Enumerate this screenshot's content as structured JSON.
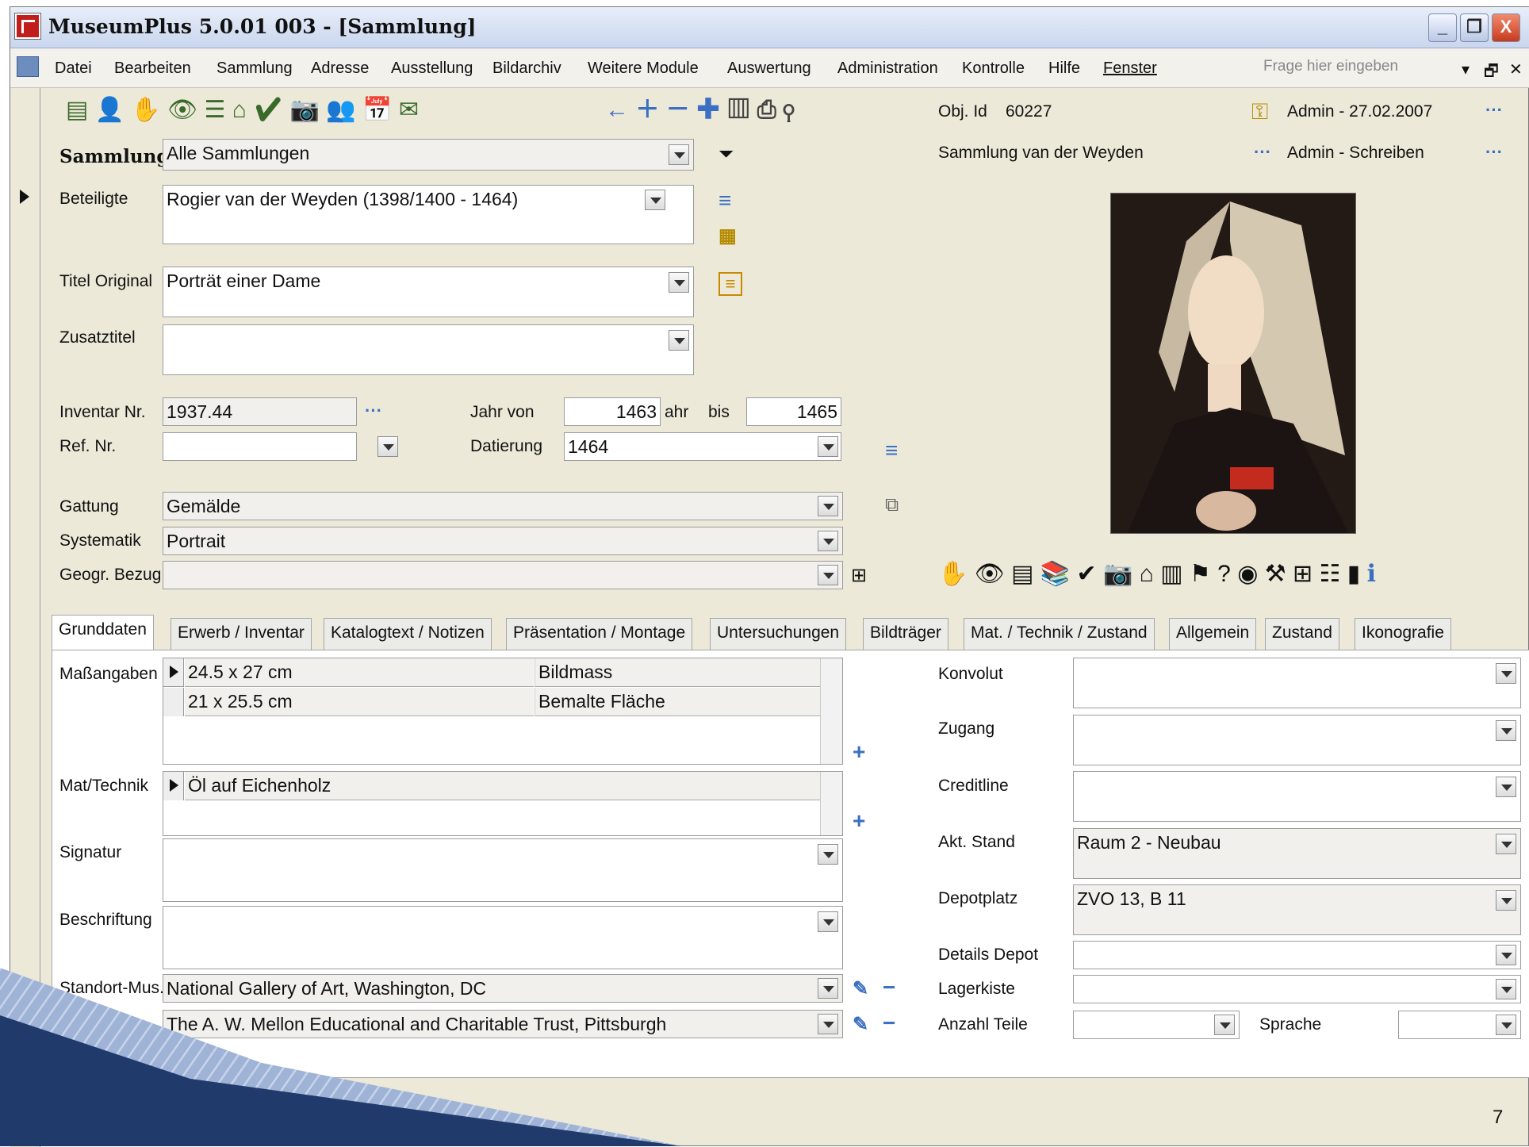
{
  "window": {
    "title": "MuseumPlus 5.0.01 003 - [Sammlung]",
    "controls": [
      "_",
      "❐",
      "X"
    ]
  },
  "menu": {
    "items": [
      "Datei",
      "Bearbeiten",
      "Sammlung",
      "Adresse",
      "Ausstellung",
      "Bildarchiv",
      "Weitere Module",
      "Auswertung",
      "Administration",
      "Kontrolle",
      "Hilfe",
      "Fenster"
    ],
    "help_placeholder": "Frage hier eingeben",
    "right_controls": [
      "▾",
      "🗗",
      "✕"
    ]
  },
  "toolbar": {
    "obj_label": "Obj. Id",
    "obj_id": "60227",
    "admin_created": "Admin - 27.02.2007",
    "admin_write": "Admin - Schreiben",
    "sammlung_selected": "Sammlung van der Weyden",
    "more": "···"
  },
  "form": {
    "sammlung_label": "Sammlung",
    "sammlung_value": "Alle Sammlungen",
    "beteiligte_label": "Beteiligte",
    "beteiligte_value": "Rogier van der Weyden (1398/1400 - 1464)",
    "titel_label": "Titel Original",
    "titel_value": "Porträt einer Dame",
    "zusatz_label": "Zusatztitel",
    "zusatz_value": "",
    "inventar_label": "Inventar Nr.",
    "inventar_value": "1937.44",
    "jahr_von_label": "Jahr von",
    "jahr_von_value": "1463",
    "jahr_suffix": "ahr",
    "bis_label": "bis",
    "bis_value": "1465",
    "ref_label": "Ref. Nr.",
    "ref_value": "",
    "datierung_label": "Datierung",
    "datierung_value": "1464",
    "gattung_label": "Gattung",
    "gattung_value": "Gemälde",
    "systematik_label": "Systematik",
    "systematik_value": "Portrait",
    "geogr_label": "Geogr. Bezug",
    "geogr_value": ""
  },
  "tabs": [
    "Grunddaten",
    "Erwerb / Inventar",
    "Katalogtext / Notizen",
    "Präsentation / Montage",
    "Untersuchungen",
    "Bildträger",
    "Mat. / Technik / Zustand",
    "Allgemein",
    "Zustand",
    "Ikonografie"
  ],
  "grunddaten": {
    "mass_label": "Maßangaben",
    "mass_rows": [
      {
        "value": "24.5 x 27 cm",
        "type": "Bildmass"
      },
      {
        "value": "21 x 25.5 cm",
        "type": "Bemalte Fläche"
      }
    ],
    "technik_label": "Mat/Technik",
    "technik_value": "Öl auf Eichenholz",
    "signatur_label": "Signatur",
    "beschriftung_label": "Beschriftung",
    "standort_label": "Standort-Mus.",
    "standort_value": "National Gallery of Art, Washington, DC",
    "standort_value2": "The A. W. Mellon Educational and Charitable Trust, Pittsburgh",
    "konvolut_label": "Konvolut",
    "zugang_label": "Zugang",
    "creditline_label": "Creditline",
    "akt_stand_label": "Akt. Stand",
    "akt_stand_value": "Raum 2 - Neubau",
    "depotplatz_label": "Depotplatz",
    "depotplatz_value": "ZVO 13, B 11",
    "details_depot_label": "Details Depot",
    "lagerkiste_label": "Lagerkiste",
    "anzahl_label": "Anzahl Teile",
    "sprache_label": "Sprache"
  },
  "page_number": "7",
  "colors": {
    "accent": "#3b6fc3",
    "titlebar": "#c9d6ee",
    "window_bg": "#ece9d8"
  }
}
